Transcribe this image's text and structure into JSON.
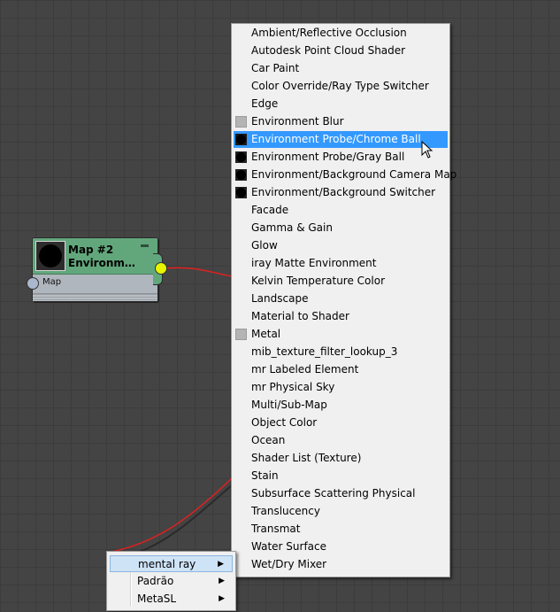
{
  "node": {
    "title_line1": "Map #2",
    "title_line2": "Environm…",
    "input_label": "Map",
    "header_color": "#62a77c",
    "output_port_color": "#e8f500",
    "wire_color": "#e02020"
  },
  "menu": {
    "items": [
      {
        "label": "Ambient/Reflective Occlusion",
        "icon": "none"
      },
      {
        "label": "Autodesk Point Cloud Shader",
        "icon": "none"
      },
      {
        "label": "Car Paint",
        "icon": "none"
      },
      {
        "label": "Color Override/Ray Type Switcher",
        "icon": "none"
      },
      {
        "label": "Edge",
        "icon": "none"
      },
      {
        "label": "Environment Blur",
        "icon": "gray-swatch-icon"
      },
      {
        "label": "Environment Probe/Chrome Ball",
        "icon": "black-ball-icon",
        "highlighted": true
      },
      {
        "label": "Environment Probe/Gray Ball",
        "icon": "black-ball-icon"
      },
      {
        "label": "Environment/Background Camera Map",
        "icon": "black-ball-icon"
      },
      {
        "label": "Environment/Background Switcher",
        "icon": "black-ball-icon"
      },
      {
        "label": "Facade",
        "icon": "none"
      },
      {
        "label": "Gamma & Gain",
        "icon": "none"
      },
      {
        "label": "Glow",
        "icon": "none"
      },
      {
        "label": "iray Matte Environment",
        "icon": "none"
      },
      {
        "label": "Kelvin Temperature Color",
        "icon": "none"
      },
      {
        "label": "Landscape",
        "icon": "none"
      },
      {
        "label": "Material to Shader",
        "icon": "none"
      },
      {
        "label": "Metal",
        "icon": "gray-swatch-icon"
      },
      {
        "label": "mib_texture_filter_lookup_3",
        "icon": "none"
      },
      {
        "label": "mr Labeled Element",
        "icon": "none"
      },
      {
        "label": "mr Physical Sky",
        "icon": "none"
      },
      {
        "label": "Multi/Sub-Map",
        "icon": "none"
      },
      {
        "label": "Object Color",
        "icon": "none"
      },
      {
        "label": "Ocean",
        "icon": "none"
      },
      {
        "label": "Shader List (Texture)",
        "icon": "none"
      },
      {
        "label": "Stain",
        "icon": "none"
      },
      {
        "label": "Subsurface Scattering Physical",
        "icon": "none"
      },
      {
        "label": "Translucency",
        "icon": "none"
      },
      {
        "label": "Transmat",
        "icon": "none"
      },
      {
        "label": "Water Surface",
        "icon": "none"
      },
      {
        "label": "Wet/Dry Mixer",
        "icon": "none"
      }
    ],
    "highlight_color": "#3399ff"
  },
  "submenu": {
    "items": [
      {
        "label": "mental ray",
        "arrow": "▶",
        "active": true
      },
      {
        "label": "Padrão",
        "arrow": "▶"
      },
      {
        "label": "MetaSL",
        "arrow": "▶"
      }
    ]
  }
}
